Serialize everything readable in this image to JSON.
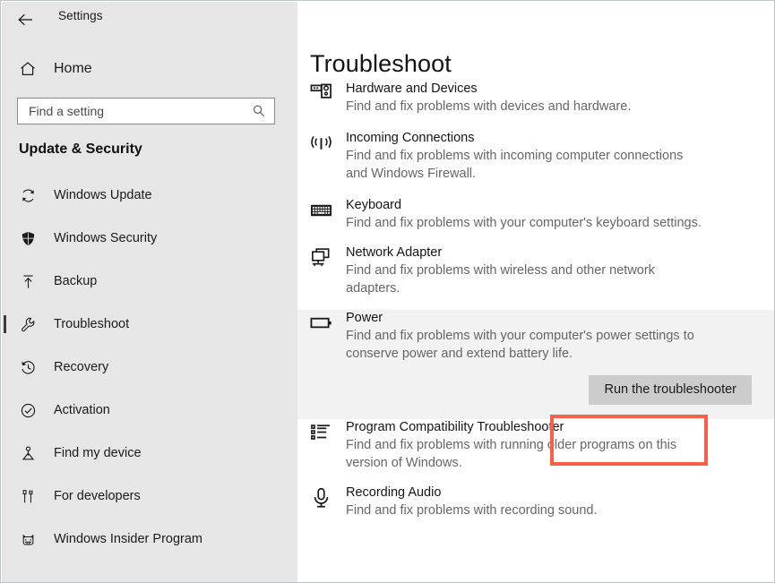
{
  "window": {
    "app_title": "Settings",
    "back_icon": "back-arrow-icon"
  },
  "sidebar": {
    "home": {
      "label": "Home",
      "icon": "home-icon"
    },
    "search": {
      "value": "",
      "placeholder": "Find a setting",
      "icon": "search-icon"
    },
    "group_title": "Update & Security",
    "items": [
      {
        "label": "Windows Update",
        "icon": "refresh-icon",
        "selected": false
      },
      {
        "label": "Windows Security",
        "icon": "shield-icon",
        "selected": false
      },
      {
        "label": "Backup",
        "icon": "backup-upload-icon",
        "selected": false
      },
      {
        "label": "Troubleshoot",
        "icon": "wrench-icon",
        "selected": true
      },
      {
        "label": "Recovery",
        "icon": "history-clock-icon",
        "selected": false
      },
      {
        "label": "Activation",
        "icon": "check-circle-icon",
        "selected": false
      },
      {
        "label": "Find my device",
        "icon": "locator-pin-icon",
        "selected": false
      },
      {
        "label": "For developers",
        "icon": "dev-tools-icon",
        "selected": false
      },
      {
        "label": "Windows Insider Program",
        "icon": "insider-cat-icon",
        "selected": false
      }
    ]
  },
  "main": {
    "page_title": "Troubleshoot",
    "troubleshooters": [
      {
        "name": "Hardware and Devices",
        "description": "Find and fix problems with devices and hardware.",
        "icon": "hardware-device-icon",
        "highlighted": false
      },
      {
        "name": "Incoming Connections",
        "description": "Find and fix problems with incoming computer connections and Windows Firewall.",
        "icon": "wireless-signal-icon",
        "highlighted": false
      },
      {
        "name": "Keyboard",
        "description": "Find and fix problems with your computer's keyboard settings.",
        "icon": "keyboard-icon",
        "highlighted": false
      },
      {
        "name": "Network Adapter",
        "description": "Find and fix problems with wireless and other network adapters.",
        "icon": "network-adapter-icon",
        "highlighted": false
      },
      {
        "name": "Power",
        "description": "Find and fix problems with your computer's power settings to conserve power and extend battery life.",
        "icon": "battery-icon",
        "highlighted": true,
        "action_label": "Run the troubleshooter"
      },
      {
        "name": "Program Compatibility Troubleshooter",
        "description": "Find and fix problems with running older programs on this version of Windows.",
        "icon": "bulleted-list-icon",
        "highlighted": false
      },
      {
        "name": "Recording Audio",
        "description": "Find and fix problems with recording sound.",
        "icon": "microphone-icon",
        "highlighted": false
      }
    ]
  },
  "annotation": {
    "target": "Run the troubleshooter",
    "color": "#f4604a"
  },
  "colors": {
    "sidebar_background": "#e6e6e6",
    "main_background": "#ffffff",
    "highlight_row": "#f2f2f2",
    "button_background": "#cccccc",
    "annotation_red": "#f4604a",
    "selection_bar": "#3c3c3c",
    "window_border": "#b9c5cd"
  }
}
